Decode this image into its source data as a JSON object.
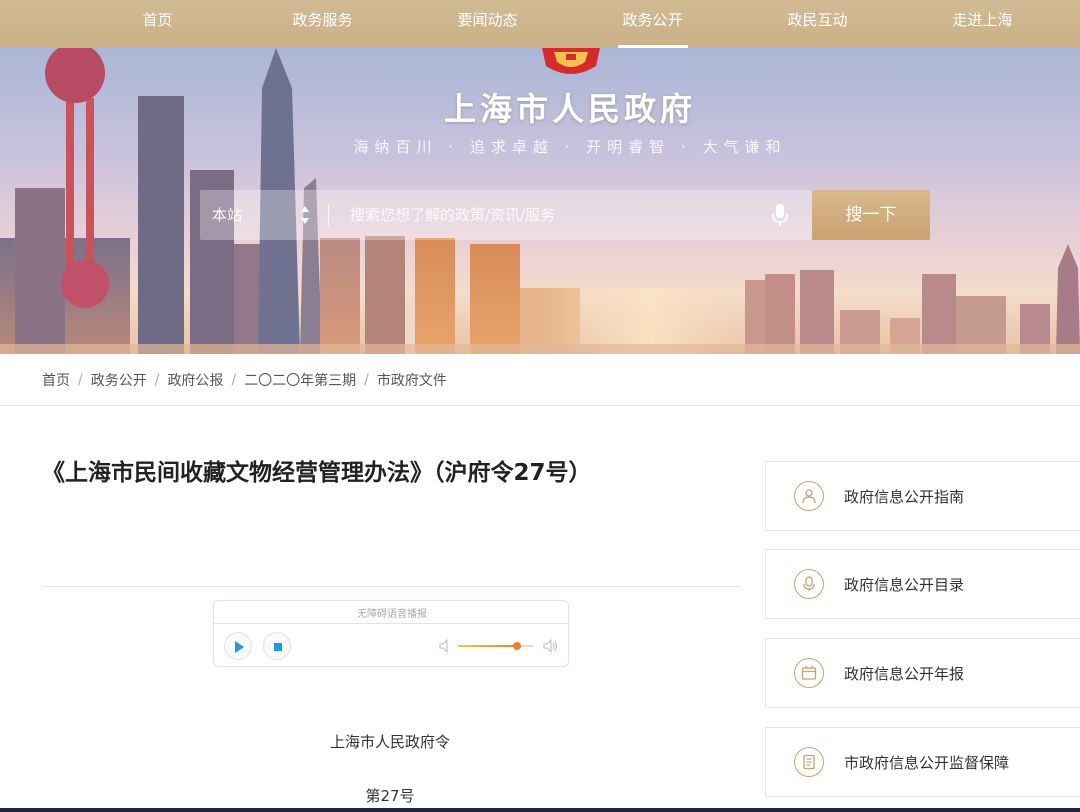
{
  "nav": {
    "items": [
      {
        "label": "首页"
      },
      {
        "label": "政务服务"
      },
      {
        "label": "要闻动态"
      },
      {
        "label": "政务公开"
      },
      {
        "label": "政民互动"
      },
      {
        "label": "走进上海"
      }
    ],
    "active_index": 3
  },
  "header": {
    "site_title": "上海市人民政府",
    "slogan": "海纳百川 · 追求卓越 · 开明睿智 · 大气谦和"
  },
  "search": {
    "scope": "本站",
    "placeholder": "搜索您想了解的政策/资讯/服务",
    "button_label": "搜一下"
  },
  "breadcrumb": [
    "首页",
    "政务公开",
    "政府公报",
    "二〇二〇年第三期",
    "市政府文件"
  ],
  "article": {
    "title": "《上海市民间收藏文物经营管理办法》（沪府令27号）",
    "player": {
      "label": "无障碍语音播报",
      "volume": 0.78
    },
    "issuer": "上海市人民政府令",
    "number": "第27号"
  },
  "sidebar": {
    "items": [
      {
        "label": "政府信息公开指南",
        "icon": "person-icon"
      },
      {
        "label": "政府信息公开目录",
        "icon": "microphone-icon"
      },
      {
        "label": "政府信息公开年报",
        "icon": "calendar-icon"
      },
      {
        "label": "市政府信息公开监督保障",
        "icon": "document-icon"
      }
    ]
  },
  "colors": {
    "nav_bg": "#c9b087",
    "accent_gold": "#c9a271",
    "volume_fill": "#f07f2a"
  }
}
